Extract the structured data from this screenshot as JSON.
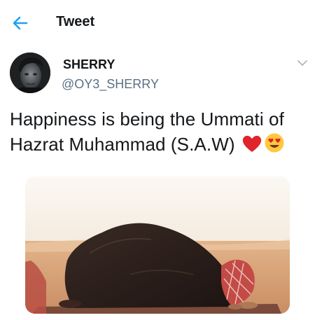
{
  "header": {
    "back_icon": "arrow-left-icon",
    "title": "Tweet"
  },
  "tweet": {
    "author": {
      "display_name": "SHERRY",
      "handle": "@OY3_SHERRY",
      "avatar_icon": "avatar-portrait"
    },
    "more_icon": "chevron-down-icon",
    "text_line1": "Happiness is being the Ummati of",
    "text_line2": "Hazrat Muhammad (S.A.W)",
    "emojis": [
      "red-heart-emoji",
      "heart-eyes-emoji"
    ],
    "media": {
      "icon": "photo-prayer-sajdah"
    }
  },
  "colors": {
    "accent": "#1da1f2",
    "text_primary": "#14171a",
    "text_secondary": "#5b7083",
    "heart": "#e0242b",
    "emoji_face": "#ffc83d"
  }
}
